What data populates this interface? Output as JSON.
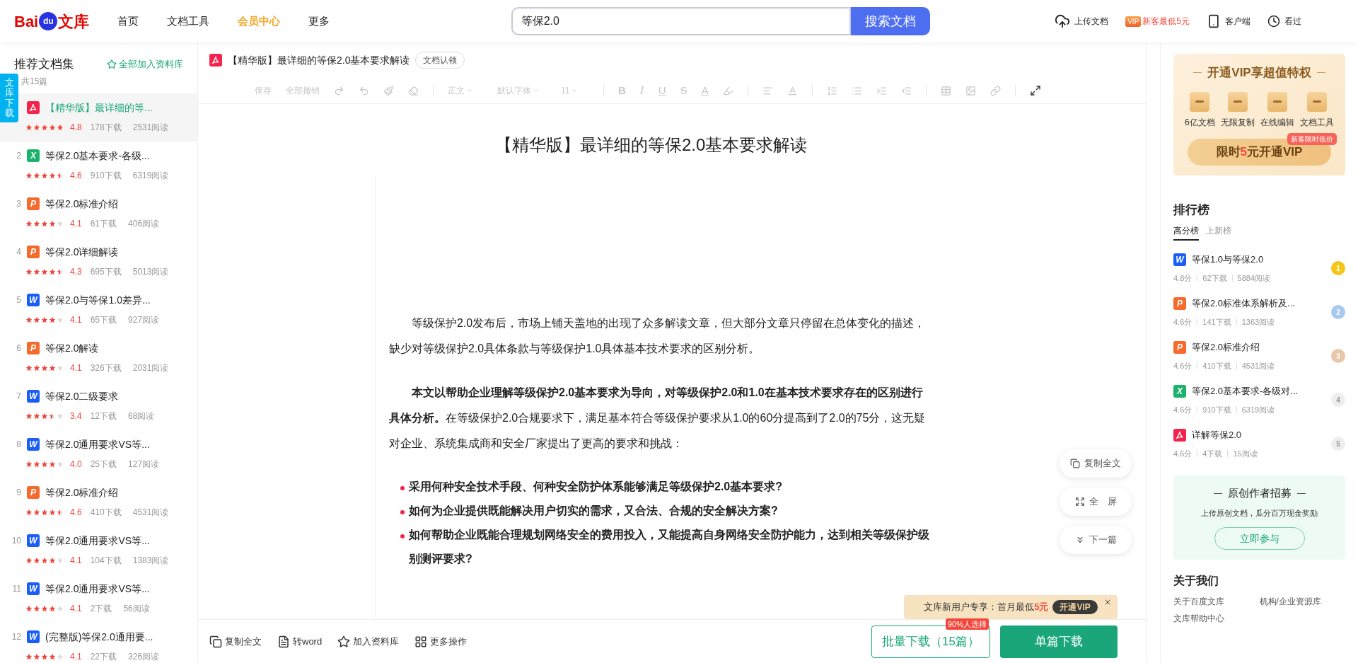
{
  "header": {
    "logo": {
      "left": "Bai",
      "paw": "du",
      "right": "文库"
    },
    "nav": [
      {
        "label": "首页",
        "selected": false
      },
      {
        "label": "文档工具",
        "selected": false
      },
      {
        "label": "会员中心",
        "selected": true
      },
      {
        "label": "更多",
        "selected": false
      }
    ],
    "search": {
      "value": "等保2.0",
      "button": "搜索文档"
    },
    "upload": "上传文档",
    "vip_badge": "VIP",
    "vip_offer": "新客最低5元",
    "client": "客户端",
    "history": "看过"
  },
  "sidebar": {
    "title": "推荐文档集",
    "add_all": "全部加入资料库",
    "count": "共15篇",
    "download_tab": "文库下载",
    "items": [
      {
        "kind": "pdf",
        "title": "【精华版】最详细的等...",
        "rating": "4.8",
        "stars": 5,
        "downloads": "178下载",
        "reads": "2531阅读",
        "selected": true
      },
      {
        "index": "2",
        "kind": "excel",
        "badge": "X",
        "title": "等保2.0基本要求-各级...",
        "rating": "4.6",
        "stars": 4.5,
        "downloads": "910下载",
        "reads": "6319阅读",
        "selected": false
      },
      {
        "index": "3",
        "kind": "ppt",
        "badge": "P",
        "title": "等保2.0标准介绍",
        "rating": "4.1",
        "stars": 4,
        "downloads": "61下载",
        "reads": "406阅读",
        "selected": false
      },
      {
        "index": "4",
        "kind": "ppt",
        "badge": "P",
        "title": "等保2.0详细解读",
        "rating": "4.3",
        "stars": 4.5,
        "downloads": "695下载",
        "reads": "5013阅读",
        "selected": false
      },
      {
        "index": "5",
        "kind": "word",
        "badge": "W",
        "title": "等保2.0与等保1.0差异...",
        "rating": "4.1",
        "stars": 4,
        "downloads": "65下载",
        "reads": "927阅读",
        "selected": false
      },
      {
        "index": "6",
        "kind": "ppt",
        "badge": "P",
        "title": "等保2.0解读",
        "rating": "4.1",
        "stars": 4,
        "downloads": "326下载",
        "reads": "2031阅读",
        "selected": false
      },
      {
        "index": "7",
        "kind": "word",
        "badge": "W",
        "title": "等保2.0二级要求",
        "rating": "3.4",
        "stars": 3.5,
        "downloads": "12下载",
        "reads": "68阅读",
        "selected": false
      },
      {
        "index": "8",
        "kind": "word",
        "badge": "W",
        "title": "等保2.0通用要求VS等...",
        "rating": "4.0",
        "stars": 4,
        "downloads": "25下载",
        "reads": "127阅读",
        "selected": false
      },
      {
        "index": "9",
        "kind": "ppt",
        "badge": "P",
        "title": "等保2.0标准介绍",
        "rating": "4.6",
        "stars": 4.5,
        "downloads": "410下载",
        "reads": "4531阅读",
        "selected": false
      },
      {
        "index": "10",
        "kind": "word",
        "badge": "W",
        "title": "等保2.0通用要求VS等...",
        "rating": "4.1",
        "stars": 4,
        "downloads": "104下载",
        "reads": "1383阅读",
        "selected": false
      },
      {
        "index": "11",
        "kind": "word",
        "badge": "W",
        "title": "等保2.0通用要求VS等...",
        "rating": "4.1",
        "stars": 4,
        "downloads": "2下载",
        "reads": "56阅读",
        "selected": false
      },
      {
        "index": "12",
        "kind": "word",
        "badge": "W",
        "title": "(完整版)等保2.0通用要...",
        "rating": "4.1",
        "stars": 4,
        "downloads": "22下载",
        "reads": "326阅读",
        "selected": false
      }
    ]
  },
  "document": {
    "title": "【精华版】最详细的等保2.0基本要求解读",
    "claim": "文档认领",
    "toolbar": {
      "disabled": true,
      "save": "保存",
      "undo_all": "全部撤销",
      "style": "正文",
      "font": "默认字体",
      "size": "11",
      "bold": "B",
      "italic": "I",
      "underline": "U",
      "strike": "S",
      "font_color_label": "A"
    },
    "page_title": "【精华版】最详细的等保2.0基本要求解读",
    "paragraphs": [
      "等级保护2.0发布后，市场上铺天盖地的出现了众多解读文章，但大部分文章只停留在总体变化的描述，缺少对等级保护2.0具体条款与等级保护1.0具体基本技术要求的区别分析。",
      "**本文以帮助企业理解等级保护2.0基本要求为导向，对等级保护2.0和1.0在基本技术要求存在的区别进行具体分析。**在等级保护2.0合规要求下，满足基本符合等级保护要求从1.0的60分提高到了2.0的75分，这无疑对企业、系统集成商和安全厂家提出了更高的要求和挑战："
    ],
    "bullets": [
      "采用何种安全技术手段、何种安全防护体系能够满足等级保护2.0基本要求?",
      "如何为企业提供既能解决用户切实的需求，又合法、合规的安全解决方案?",
      "如何帮助企业既能合理规划网络安全的费用投入，又能提高自身网络安全防护能力，达到相关等级保护级别测评要求?"
    ],
    "float_actions": [
      "复制全文",
      "全　屏",
      "下一篇"
    ],
    "promo": {
      "text": "文库新用户专享：首月最低",
      "price": "5元",
      "button": "开通VIP"
    },
    "bottom": {
      "actions": [
        "复制全文",
        "转word",
        "加入资料库",
        "更多操作"
      ],
      "batch": "批量下载（15篇）",
      "batch_badge": "90%人选择",
      "single": "单篇下载"
    }
  },
  "right": {
    "vip": {
      "title": "开通VIP享超值特权",
      "benefits": [
        "6亿文档",
        "无限复制",
        "在线编辑",
        "文档工具"
      ],
      "tag": "新客限时低价",
      "button": {
        "prefix": "限时",
        "price": "5",
        "suffix": "元开通VIP"
      }
    },
    "ranking": {
      "title": "排行榜",
      "tabs": [
        {
          "label": "高分榜",
          "selected": true
        },
        {
          "label": "上新榜",
          "selected": false
        }
      ],
      "items": [
        {
          "kind": "word",
          "badge": "W",
          "title": "等保1.0与等保2.0",
          "score": "4.8分",
          "downloads": "62下载",
          "reads": "5884阅读",
          "rank": "1",
          "color": "#f5c518"
        },
        {
          "kind": "ppt",
          "badge": "P",
          "title": "等保2.0标准体系解析及...",
          "score": "4.6分",
          "downloads": "141下载",
          "reads": "1363阅读",
          "rank": "2",
          "color": "#a9c8f0"
        },
        {
          "kind": "ppt",
          "badge": "P",
          "title": "等保2.0标准介绍",
          "score": "4.6分",
          "downloads": "410下载",
          "reads": "4531阅读",
          "rank": "3",
          "color": "#e8c7a8"
        },
        {
          "kind": "excel",
          "badge": "X",
          "title": "等保2.0基本要求-各级对...",
          "score": "4.6分",
          "downloads": "910下载",
          "reads": "6319阅读",
          "rank": "4",
          "color": "#eeeeee"
        },
        {
          "kind": "pdf",
          "title": "详解等保2.0",
          "score": "4.6分",
          "downloads": "4下载",
          "reads": "15阅读",
          "rank": "5",
          "color": "#eeeeee"
        }
      ]
    },
    "recruit": {
      "title": "原创作者招募",
      "text": "上传原创文档，瓜分百万现金奖励",
      "button": "立即参与"
    },
    "about": {
      "title": "关于我们",
      "links": [
        "关于百度文库",
        "机构/企业资源库",
        "文库帮助中心"
      ]
    }
  }
}
